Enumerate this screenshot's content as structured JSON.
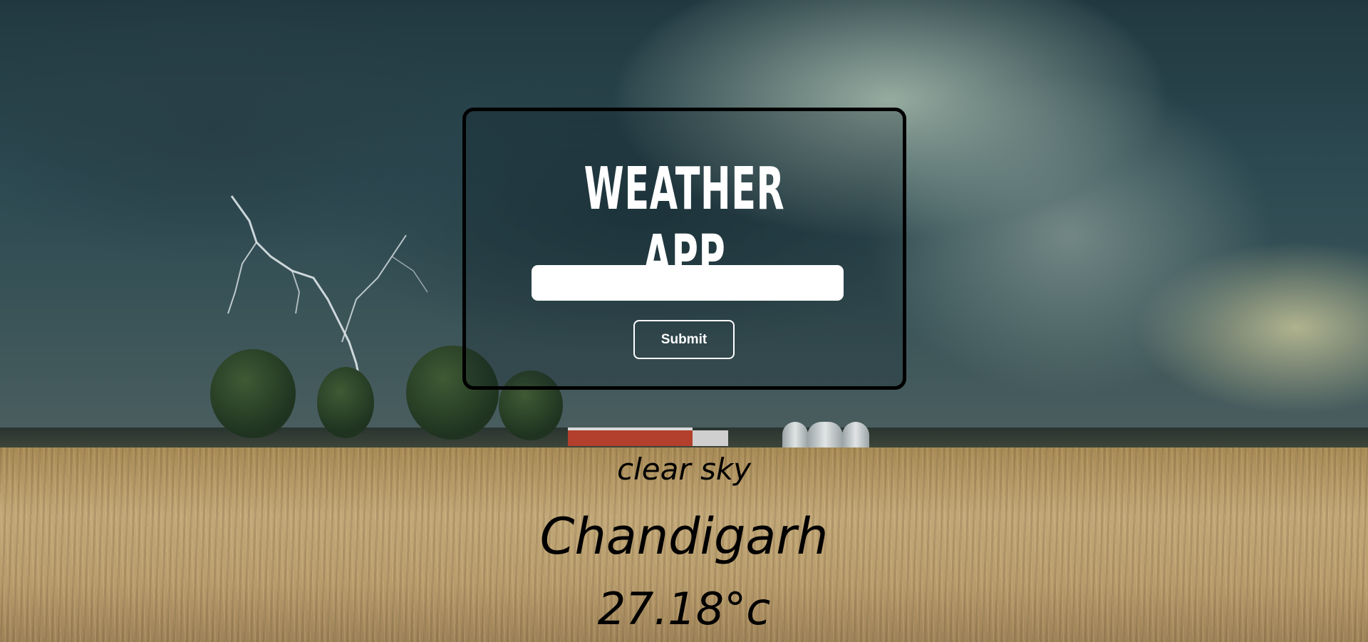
{
  "app": {
    "title": "WEATHER APP"
  },
  "search": {
    "value": "",
    "placeholder": ""
  },
  "form": {
    "submit_label": "Submit"
  },
  "result": {
    "description": "clear sky",
    "city": "Chandigarh",
    "temperature": "27.18°c"
  },
  "colors": {
    "card_border": "#000000",
    "title_text": "#ffffff",
    "result_text": "#000000"
  }
}
